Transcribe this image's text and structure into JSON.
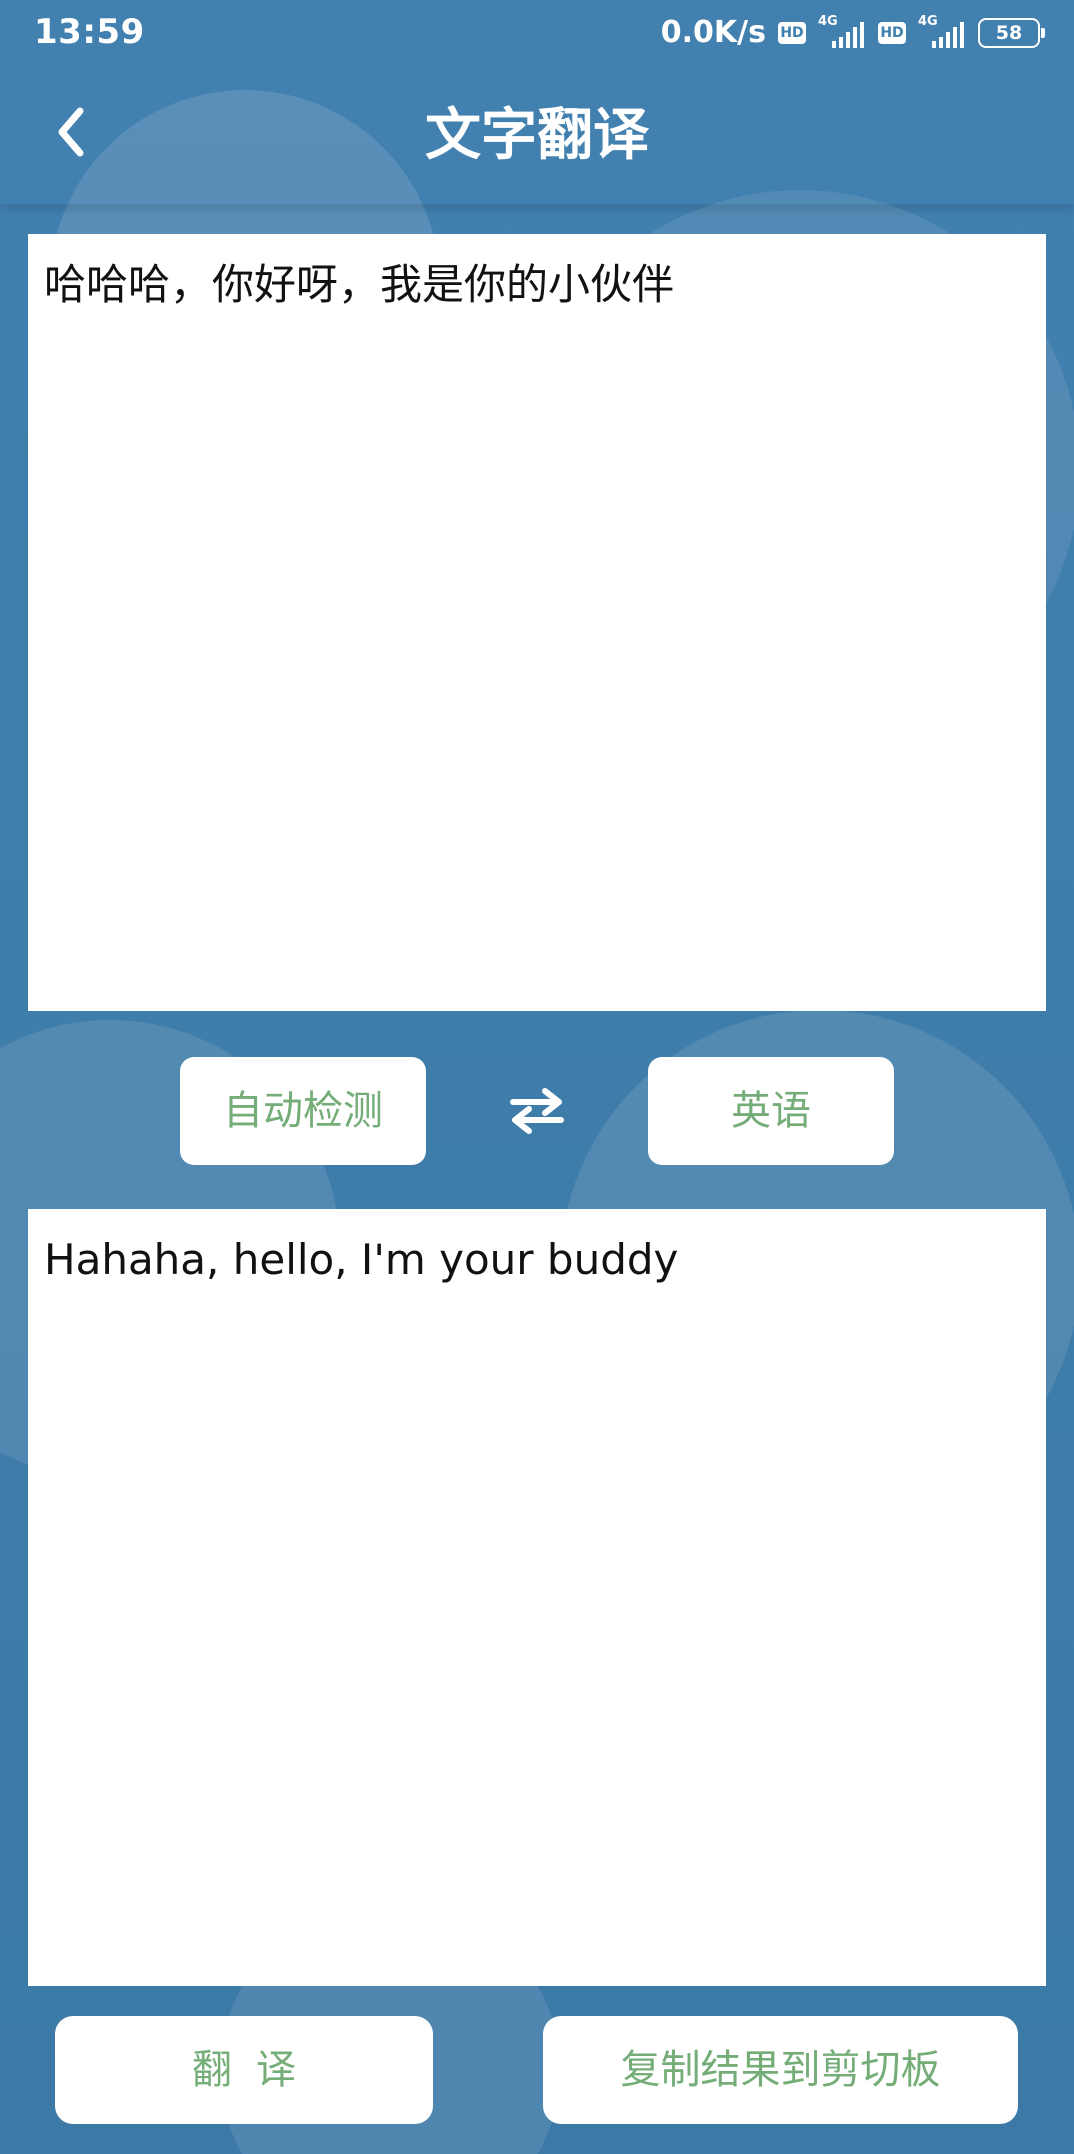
{
  "status_bar": {
    "time": "13:59",
    "network_speed": "0.0K/s",
    "hd_badge_1": "HD",
    "hd_badge_2": "HD",
    "network_type_1": "4G",
    "network_type_2": "4G",
    "battery": "58"
  },
  "app_bar": {
    "title": "文字翻译",
    "back_icon": "back-arrow-icon"
  },
  "translation": {
    "source_text": "哈哈哈，你好呀，我是你的小伙伴",
    "result_text": "Hahaha, hello, I'm your buddy",
    "source_language": "自动检测",
    "target_language": "英语",
    "swap_icon": "swap-arrows-icon"
  },
  "actions": {
    "translate_label": "翻译",
    "copy_label": "复制结果到剪切板"
  },
  "colors": {
    "background": "#3f7fae",
    "panel": "#ffffff",
    "accent": "#74ad78",
    "text": "#111111",
    "status_text": "#ffffff"
  }
}
